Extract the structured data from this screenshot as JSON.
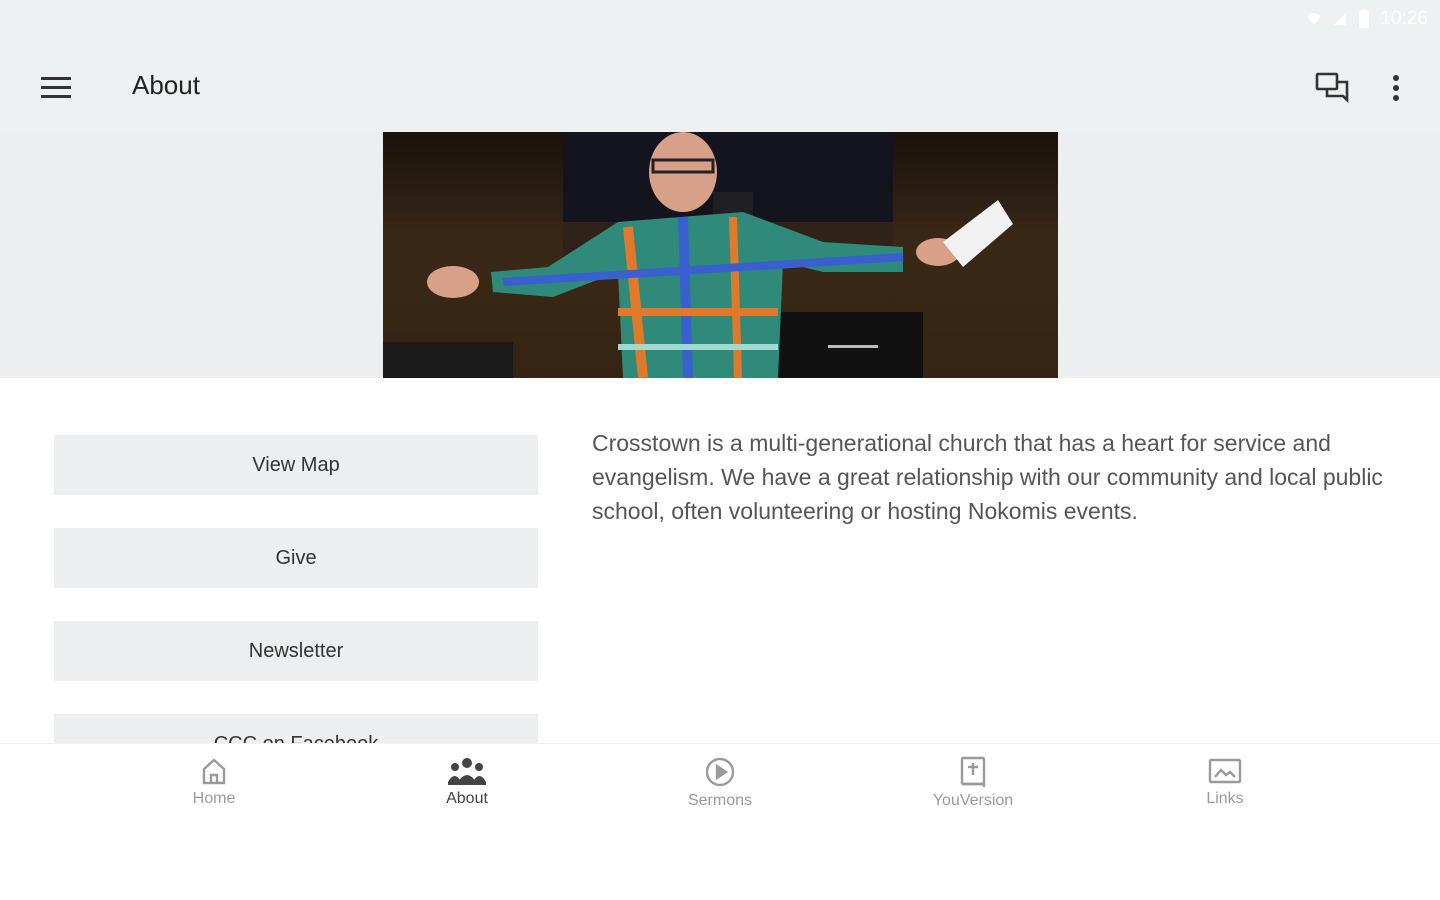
{
  "status_bar": {
    "time": "10:26"
  },
  "app_bar": {
    "title": "About"
  },
  "side_buttons": [
    {
      "label": "View Map"
    },
    {
      "label": "Give"
    },
    {
      "label": "Newsletter"
    },
    {
      "label": "CCC on Facebook"
    }
  ],
  "description": "Crosstown is a multi-generational church that has a heart for service and evangelism.  We have a great relationship with our community and local public school, often volunteering or hosting Nokomis events.",
  "bottom_nav": [
    {
      "label": "Home",
      "icon": "home-icon"
    },
    {
      "label": "About",
      "icon": "people-icon"
    },
    {
      "label": "Sermons",
      "icon": "play-icon"
    },
    {
      "label": "YouVersion",
      "icon": "bible-icon"
    },
    {
      "label": "Links",
      "icon": "image-icon"
    }
  ],
  "active_tab": "About"
}
